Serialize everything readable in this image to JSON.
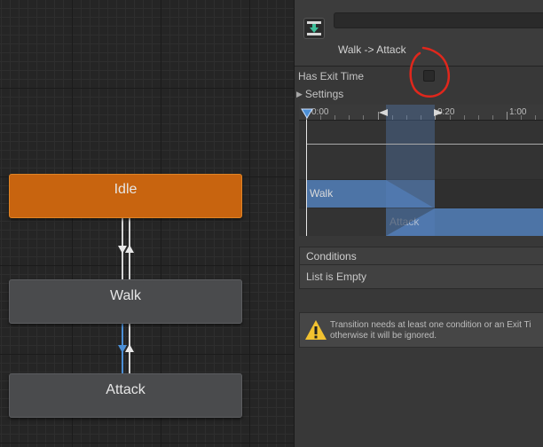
{
  "graph": {
    "states": [
      {
        "name": "Idle",
        "color": "#c8640f"
      },
      {
        "name": "Walk",
        "color": "#4a4b4d"
      },
      {
        "name": "Attack",
        "color": "#4a4b4d"
      }
    ]
  },
  "inspector": {
    "name_field_value": "",
    "title": "Walk -> Attack",
    "has_exit_time_label": "Has Exit Time",
    "has_exit_time_checked": false,
    "settings_label": "Settings",
    "timeline": {
      "tick_labels": [
        "0:00",
        "0:20",
        "1:00"
      ],
      "clips": [
        "Walk",
        "Attack"
      ],
      "highlight_color": "#5682be"
    },
    "conditions_header": "Conditions",
    "conditions_empty": "List is Empty",
    "warning_line1": "Transition needs at least one condition or an Exit Ti",
    "warning_line2": "otherwise it will be ignored."
  },
  "annotation": {
    "color": "#e0271c"
  }
}
